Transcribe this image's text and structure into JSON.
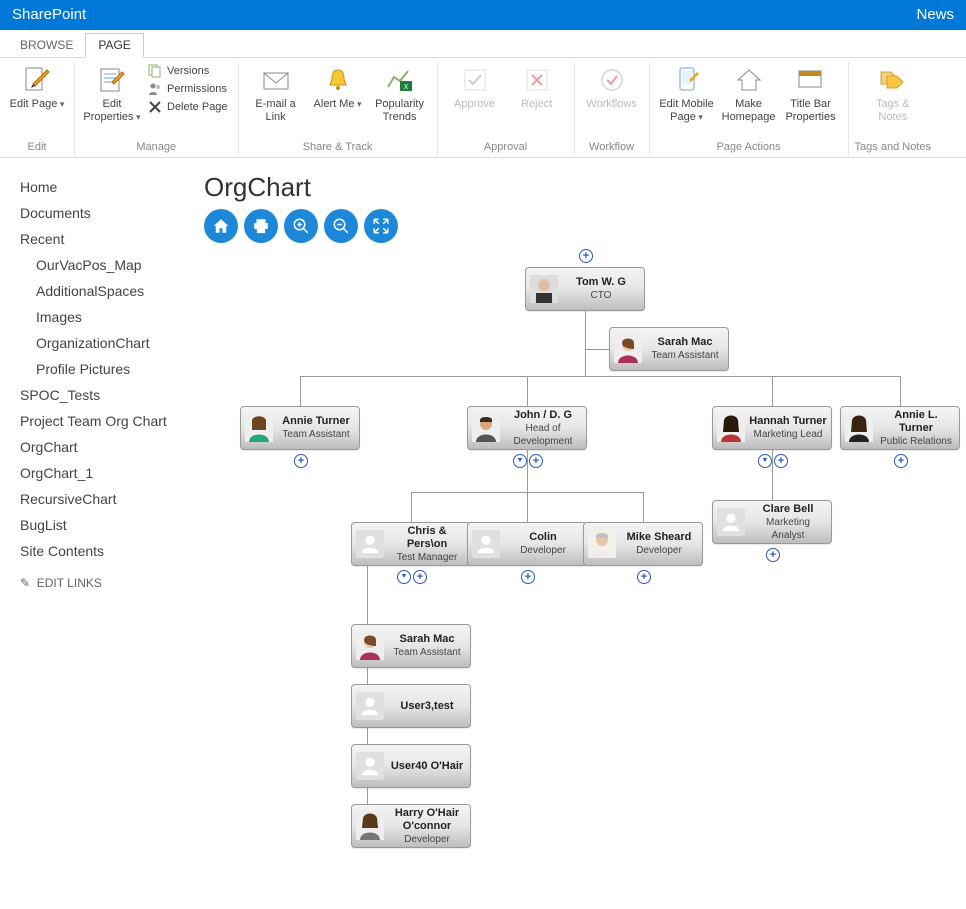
{
  "topbar": {
    "brand": "SharePoint",
    "right": "News"
  },
  "tabs": {
    "browse": "BROWSE",
    "page": "PAGE"
  },
  "ribbon": {
    "edit": {
      "editpage": "Edit Page",
      "group": "Edit"
    },
    "manage": {
      "editprops": "Edit Properties",
      "versions": "Versions",
      "permissions": "Permissions",
      "deletepage": "Delete Page",
      "group": "Manage"
    },
    "share": {
      "email": "E-mail a Link",
      "alert": "Alert Me",
      "popularity": "Popularity Trends",
      "group": "Share & Track"
    },
    "approval": {
      "approve": "Approve",
      "reject": "Reject",
      "group": "Approval"
    },
    "workflow": {
      "workflows": "Workflows",
      "group": "Workflow"
    },
    "pageactions": {
      "editmobile": "Edit Mobile Page",
      "makehome": "Make Homepage",
      "titlebar": "Title Bar Properties",
      "group": "Page Actions"
    },
    "tags": {
      "tagsnotes": "Tags & Notes",
      "group": "Tags and Notes"
    }
  },
  "sidebar": {
    "home": "Home",
    "documents": "Documents",
    "recent": "Recent",
    "sub": {
      "ourvac": "OurVacPos_Map",
      "addspaces": "AdditionalSpaces",
      "images": "Images",
      "orgchart": "OrganizationChart",
      "profilepics": "Profile Pictures"
    },
    "spoc": "SPOC_Tests",
    "projteam": "Project Team Org Chart",
    "orgchart1": "OrgChart",
    "orgchart2": "OrgChart_1",
    "recursive": "RecursiveChart",
    "buglist": "BugList",
    "sitecontents": "Site Contents",
    "editlinks": "EDIT LINKS"
  },
  "page": {
    "title": "OrgChart"
  },
  "nodes": {
    "tom": {
      "name": "Tom W. G",
      "title": "CTO"
    },
    "sarah1": {
      "name": "Sarah Mac",
      "title": "Team Assistant"
    },
    "annie": {
      "name": "Annie Turner",
      "title": "Team Assistant"
    },
    "john": {
      "name": "John / D. G",
      "title": "Head of Development"
    },
    "hannah": {
      "name": "Hannah Turner",
      "title": "Marketing Lead"
    },
    "anniel": {
      "name": "Annie L. Turner",
      "title": "Public Relations"
    },
    "clare": {
      "name": "Clare Bell",
      "title": "Marketing Analyst"
    },
    "chris": {
      "name": "Chris & Pers\\on",
      "title": "Test Manager"
    },
    "colin": {
      "name": "Colin",
      "title": "Developer"
    },
    "mike": {
      "name": "Mike Sheard",
      "title": "Developer"
    },
    "sarah2": {
      "name": "Sarah Mac",
      "title": "Team Assistant"
    },
    "user3": {
      "name": "User3,test",
      "title": ""
    },
    "user40": {
      "name": "User40 O'Hair",
      "title": ""
    },
    "harry": {
      "name": "Harry O'Hair O'connor",
      "title": "Developer"
    }
  }
}
